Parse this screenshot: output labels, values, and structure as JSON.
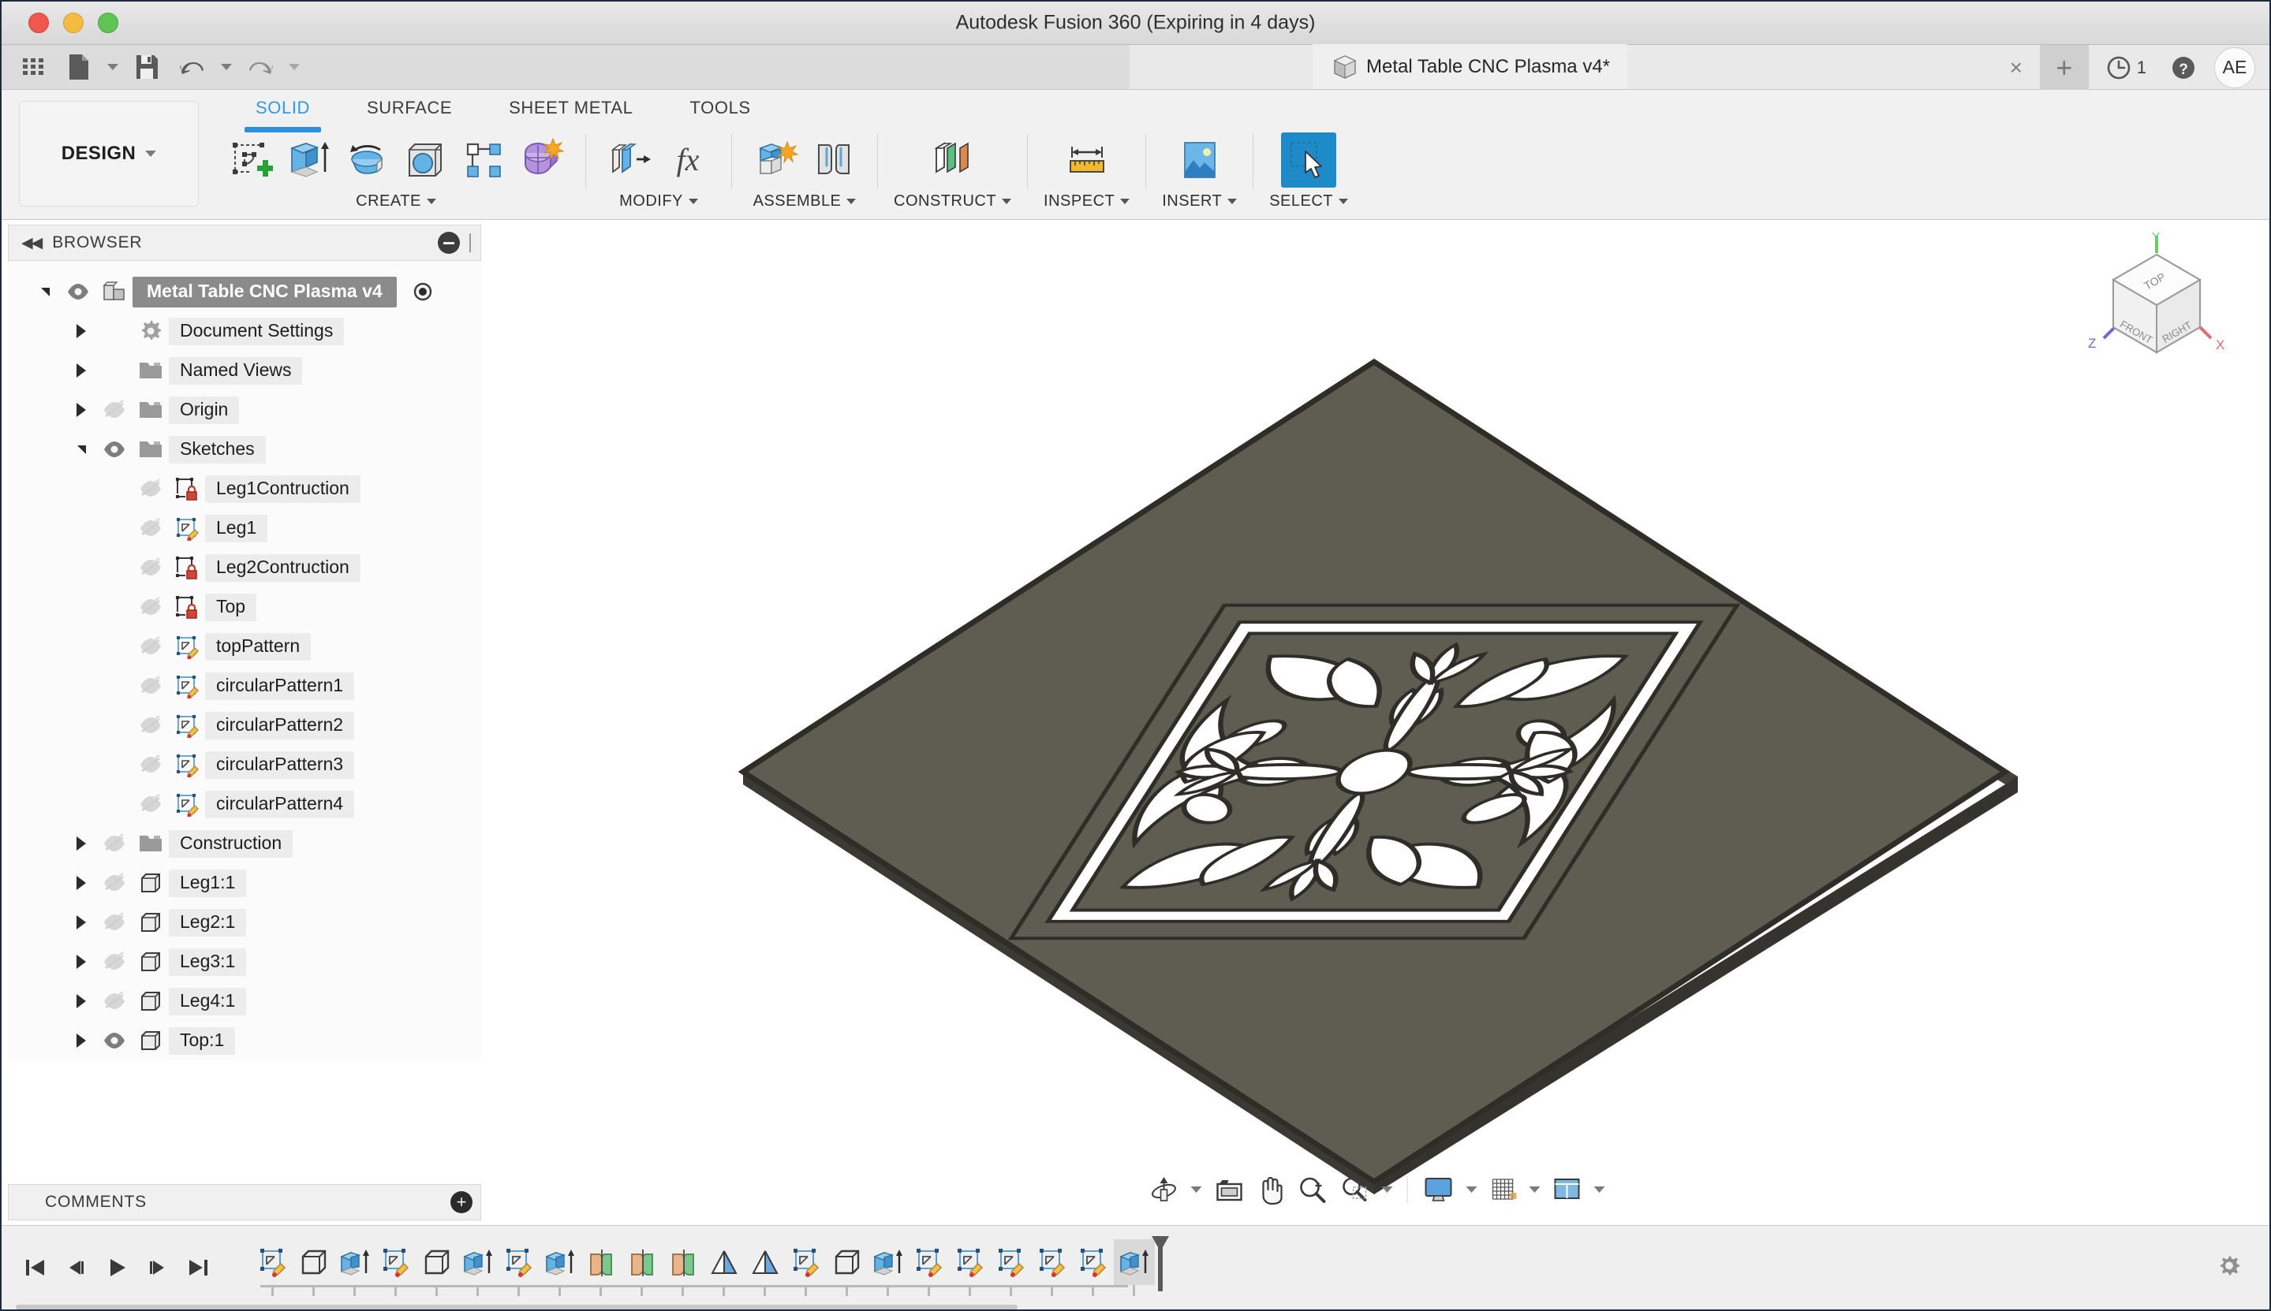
{
  "window": {
    "app_title": "Autodesk Fusion 360 (Expiring in 4 days)",
    "traffic_lights": [
      "close",
      "minimize",
      "maximize"
    ]
  },
  "quick_access": {
    "items": [
      {
        "name": "show-data-panel",
        "icon": "grid-icon",
        "label": "Show Data Panel"
      },
      {
        "name": "file-menu",
        "icon": "file-icon",
        "label": "File",
        "caret": true
      },
      {
        "name": "save-button",
        "icon": "save-icon",
        "label": "Save"
      },
      {
        "name": "undo-button",
        "icon": "undo-icon",
        "label": "Undo",
        "caret": true
      },
      {
        "name": "redo-button",
        "icon": "redo-icon",
        "label": "Redo",
        "caret": true
      }
    ]
  },
  "document_tab": {
    "label": "Metal Table CNC Plasma v4*",
    "icon": "cube-icon",
    "close_label": "×",
    "new_tab_label": "+"
  },
  "tab_right": {
    "job_status_count": "1",
    "job_status_icon": "clock-icon",
    "help_icon": "help-icon",
    "avatar_initials": "AE"
  },
  "workspace": {
    "label": "DESIGN"
  },
  "ribbon": {
    "tabs": [
      {
        "label": "SOLID",
        "active": true
      },
      {
        "label": "SURFACE",
        "active": false
      },
      {
        "label": "SHEET METAL",
        "active": false
      },
      {
        "label": "TOOLS",
        "active": false
      }
    ],
    "groups": [
      {
        "label": "CREATE",
        "has_caret": true,
        "tools": [
          {
            "name": "create-sketch-button",
            "icon": "create-sketch-icon"
          },
          {
            "name": "extrude-button",
            "icon": "extrude-icon"
          },
          {
            "name": "revolve-button",
            "icon": "revolve-icon"
          },
          {
            "name": "hole-button",
            "icon": "hole-icon"
          },
          {
            "name": "pattern-button",
            "icon": "rectangular-pattern-icon"
          },
          {
            "name": "create-form-button",
            "icon": "form-sculpt-icon"
          }
        ]
      },
      {
        "label": "MODIFY",
        "has_caret": true,
        "tools": [
          {
            "name": "press-pull-button",
            "icon": "press-pull-icon"
          },
          {
            "name": "change-parameters-button",
            "icon": "fx-icon"
          }
        ]
      },
      {
        "label": "ASSEMBLE",
        "has_caret": true,
        "tools": [
          {
            "name": "new-component-button",
            "icon": "new-component-icon"
          },
          {
            "name": "joint-button",
            "icon": "joint-icon"
          }
        ]
      },
      {
        "label": "CONSTRUCT",
        "has_caret": true,
        "tools": [
          {
            "name": "construct-plane-button",
            "icon": "offset-plane-icon"
          }
        ]
      },
      {
        "label": "INSPECT",
        "has_caret": true,
        "tools": [
          {
            "name": "measure-button",
            "icon": "measure-icon"
          }
        ]
      },
      {
        "label": "INSERT",
        "has_caret": true,
        "tools": [
          {
            "name": "insert-image-button",
            "icon": "canvas-image-icon"
          }
        ]
      },
      {
        "label": "SELECT",
        "has_caret": true,
        "selected": true,
        "tools": [
          {
            "name": "select-button",
            "icon": "select-cursor-icon"
          }
        ]
      }
    ]
  },
  "browser": {
    "title": "BROWSER",
    "collapse_label": "◀◀",
    "tree": [
      {
        "label": "Metal Table CNC Plasma v4",
        "depth": 0,
        "expander": "open",
        "visibility": "visible",
        "icon": "component-icon",
        "root": true,
        "has_radio": true
      },
      {
        "label": "Document Settings",
        "depth": 1,
        "expander": "closed",
        "visibility": "none",
        "icon": "gear-icon"
      },
      {
        "label": "Named Views",
        "depth": 1,
        "expander": "closed",
        "visibility": "none",
        "icon": "folder-icon"
      },
      {
        "label": "Origin",
        "depth": 1,
        "expander": "closed",
        "visibility": "hidden",
        "icon": "folder-icon"
      },
      {
        "label": "Sketches",
        "depth": 1,
        "expander": "open",
        "visibility": "visible",
        "icon": "folder-icon"
      },
      {
        "label": "Leg1Contruction",
        "depth": 2,
        "expander": "none",
        "visibility": "hidden",
        "icon": "sketch-locked-icon"
      },
      {
        "label": "Leg1",
        "depth": 2,
        "expander": "none",
        "visibility": "hidden",
        "icon": "sketch-icon"
      },
      {
        "label": "Leg2Contruction",
        "depth": 2,
        "expander": "none",
        "visibility": "hidden",
        "icon": "sketch-locked-icon"
      },
      {
        "label": "Top",
        "depth": 2,
        "expander": "none",
        "visibility": "hidden",
        "icon": "sketch-locked-icon"
      },
      {
        "label": "topPattern",
        "depth": 2,
        "expander": "none",
        "visibility": "hidden",
        "icon": "sketch-icon"
      },
      {
        "label": "circularPattern1",
        "depth": 2,
        "expander": "none",
        "visibility": "hidden",
        "icon": "sketch-icon"
      },
      {
        "label": "circularPattern2",
        "depth": 2,
        "expander": "none",
        "visibility": "hidden",
        "icon": "sketch-icon"
      },
      {
        "label": "circularPattern3",
        "depth": 2,
        "expander": "none",
        "visibility": "hidden",
        "icon": "sketch-icon"
      },
      {
        "label": "circularPattern4",
        "depth": 2,
        "expander": "none",
        "visibility": "hidden",
        "icon": "sketch-icon"
      },
      {
        "label": "Construction",
        "depth": 1,
        "expander": "closed",
        "visibility": "hidden",
        "icon": "folder-icon"
      },
      {
        "label": "Leg1:1",
        "depth": 1,
        "expander": "closed",
        "visibility": "hidden",
        "icon": "body-icon"
      },
      {
        "label": "Leg2:1",
        "depth": 1,
        "expander": "closed",
        "visibility": "hidden",
        "icon": "body-icon"
      },
      {
        "label": "Leg3:1",
        "depth": 1,
        "expander": "closed",
        "visibility": "hidden",
        "icon": "body-icon"
      },
      {
        "label": "Leg4:1",
        "depth": 1,
        "expander": "closed",
        "visibility": "hidden",
        "icon": "body-icon"
      },
      {
        "label": "Top:1",
        "depth": 1,
        "expander": "closed",
        "visibility": "visible",
        "icon": "body-icon"
      }
    ]
  },
  "comments": {
    "title": "COMMENTS",
    "add_label": "+"
  },
  "viewcube": {
    "top_face": "TOP",
    "front_face": "FRONT",
    "right_face": "RIGHT",
    "axis_x": "X",
    "axis_y": "Y",
    "axis_z": "Z",
    "axis_x_color": "#e06c6c",
    "axis_y_color": "#69cc69",
    "axis_z_color": "#6a6ad8"
  },
  "model": {
    "name": "ornamental-cnc-panel",
    "surface_color": "#5f5d52",
    "edge_color": "#2e2d28"
  },
  "navbar": {
    "items": [
      {
        "name": "orbit-button",
        "icon": "orbit-icon",
        "caret": true
      },
      {
        "name": "look-at-button",
        "icon": "look-at-icon",
        "caret": false
      },
      {
        "name": "pan-button",
        "icon": "pan-hand-icon",
        "caret": false
      },
      {
        "name": "zoom-button",
        "icon": "zoom-in-icon",
        "caret": false
      },
      {
        "name": "fit-button",
        "icon": "zoom-fit-icon",
        "caret": true
      },
      {
        "name": "display-settings-button",
        "icon": "display-monitor-icon",
        "caret": true
      },
      {
        "name": "grid-snaps-button",
        "icon": "grid-icon",
        "caret": true
      },
      {
        "name": "viewports-button",
        "icon": "viewports-icon",
        "caret": true
      }
    ]
  },
  "timeline": {
    "playback": [
      {
        "name": "timeline-go-to-beginning",
        "icon": "skip-start-icon"
      },
      {
        "name": "timeline-step-back",
        "icon": "step-back-icon"
      },
      {
        "name": "timeline-play",
        "icon": "play-icon"
      },
      {
        "name": "timeline-step-forward",
        "icon": "step-forward-icon"
      },
      {
        "name": "timeline-go-to-end",
        "icon": "skip-end-icon"
      }
    ],
    "features": [
      {
        "icon": "sketch-icon"
      },
      {
        "icon": "body-icon"
      },
      {
        "icon": "extrude-icon"
      },
      {
        "icon": "sketch-icon"
      },
      {
        "icon": "body-icon"
      },
      {
        "icon": "extrude-icon"
      },
      {
        "icon": "sketch-icon"
      },
      {
        "icon": "extrude-icon"
      },
      {
        "icon": "mirror-icon"
      },
      {
        "icon": "mirror-icon"
      },
      {
        "icon": "mirror-icon"
      },
      {
        "icon": "plane-icon"
      },
      {
        "icon": "plane-icon"
      },
      {
        "icon": "sketch-icon"
      },
      {
        "icon": "body-icon"
      },
      {
        "icon": "extrude-icon"
      },
      {
        "icon": "sketch-icon"
      },
      {
        "icon": "sketch-icon"
      },
      {
        "icon": "sketch-icon"
      },
      {
        "icon": "sketch-icon"
      },
      {
        "icon": "sketch-icon"
      },
      {
        "icon": "extrude-icon",
        "current": true
      }
    ],
    "settings_icon": "gear-icon"
  }
}
